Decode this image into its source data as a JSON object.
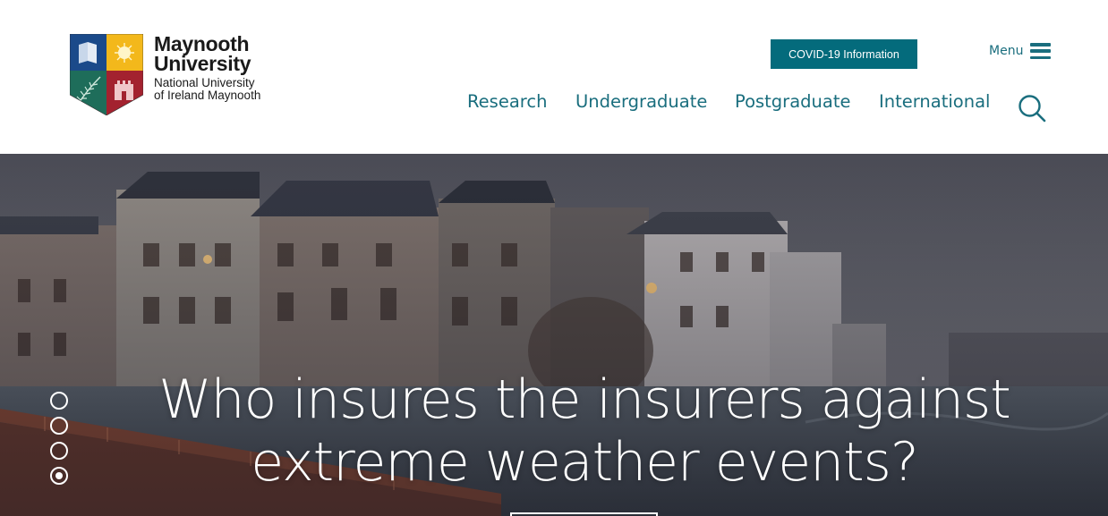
{
  "brand": {
    "name_line1": "Maynooth",
    "name_line2": "University",
    "sub_line1": "National University",
    "sub_line2": "of Ireland Maynooth"
  },
  "header": {
    "covid_label": "COVID-19 Information",
    "menu_label": "Menu"
  },
  "nav": {
    "items": [
      {
        "label": "Research"
      },
      {
        "label": "Undergraduate"
      },
      {
        "label": "Postgraduate"
      },
      {
        "label": "International"
      }
    ]
  },
  "hero": {
    "title_line1": "Who insures the insurers against",
    "title_line2": "extreme weather events?",
    "slides_count": 4,
    "active_slide": 4
  },
  "colors": {
    "brand_teal": "#046b7c",
    "nav_text": "#1a6e7e"
  },
  "icons": {
    "menu": "hamburger-icon",
    "search": "search-icon"
  }
}
